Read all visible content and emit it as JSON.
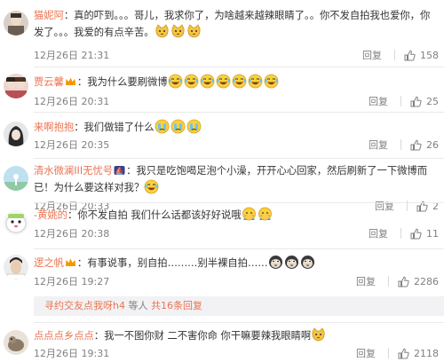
{
  "comments": [
    {
      "user": "猫妮阿",
      "sep": "：",
      "text": "真的吓到。。。哥儿，我求你了，为啥越来越辣眼睛了。。你不发自拍我也爱你，你发了。。。我爱的有点辛苦。",
      "emojis": [
        "cat-face",
        "cat-face",
        "cat-face"
      ],
      "time": "12月26日 21:31",
      "reply": "回复",
      "likes": "158"
    },
    {
      "user": "贾云馨",
      "sep": "：我为什么要刷微博",
      "text": "",
      "emojis": [
        "laugh-cry",
        "laugh-cry",
        "laugh-cry",
        "laugh-cry",
        "laugh-cry",
        "laugh-cry",
        "laugh-cry"
      ],
      "time": "12月26日 20:31",
      "reply": "回复",
      "likes": "25"
    },
    {
      "user": "来啊抱抱",
      "sep": "：我们做错了什么",
      "text": "",
      "emojis": [
        "crying",
        "crying",
        "crying"
      ],
      "time": "12月26日 20:35",
      "reply": "回复",
      "likes": "26"
    },
    {
      "user": "清水微澜III无忧号",
      "sep": "：",
      "text": "我只是吃饱喝足泡个小澡，开开心心回家，然后刷新了一下微博而已！为什么要这样对我？",
      "emojis": [
        "laugh-cry"
      ],
      "time": "12月26日 20:33",
      "reply": "回复",
      "likes": "2"
    },
    {
      "user": "-黄姚的",
      "sep": "：你不发自拍 我们什么话都该好好说哦",
      "text": "",
      "emojis": [
        "shy",
        "shy"
      ],
      "time": "12月26日 20:38",
      "reply": "回复",
      "likes": "11"
    },
    {
      "user": "逻之帆",
      "sep": "：有事说事，别自拍………别半裸自拍……",
      "text": "",
      "emojis": [
        "monkey",
        "monkey",
        "monkey"
      ],
      "time": "12月26日 19:27",
      "reply": "回复",
      "likes": "2286",
      "subreply": {
        "user": "寻约交友点我呀h4",
        "mid": " 等人 ",
        "count": "共16条回复"
      }
    },
    {
      "user": "点点点乡点点",
      "sep": "：我一不图你财 二不害你命 你干嘛要辣我眼睛啊",
      "text": "",
      "emojis": [
        "cat-face"
      ],
      "time": "12月26日 19:31",
      "reply": "回复",
      "likes": "2118"
    }
  ],
  "colors": {
    "name": "#eb7350",
    "meta": "#808080",
    "text": "#333333"
  }
}
